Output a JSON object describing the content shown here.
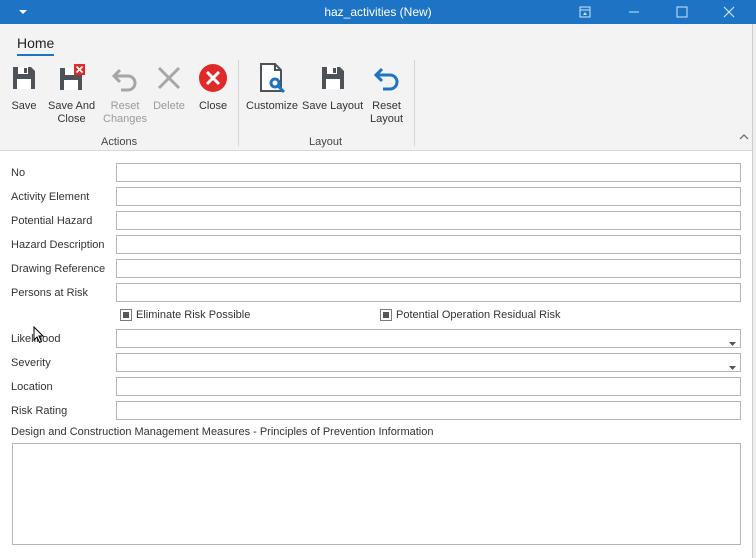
{
  "window": {
    "title": "haz_activities (New)",
    "colors": {
      "titlebar": "#1e74c4",
      "accent": "#1e74c4",
      "close_icon": "#e02a2a"
    }
  },
  "ribbon": {
    "tab": "Home",
    "groups": [
      {
        "label": "Actions"
      },
      {
        "label": "Layout"
      }
    ],
    "buttons": {
      "save": "Save",
      "save_and_close": "Save And\nClose",
      "reset_changes": "Reset\nChanges",
      "delete": "Delete",
      "close": "Close",
      "customize": "Customize",
      "save_layout": "Save Layout",
      "reset_layout": "Reset\nLayout"
    }
  },
  "form": {
    "fields": {
      "no": {
        "label": "No",
        "value": ""
      },
      "activity_element": {
        "label": "Activity Element",
        "value": ""
      },
      "potential_hazard": {
        "label": "Potential Hazard",
        "value": ""
      },
      "hazard_description": {
        "label": "Hazard Description",
        "value": ""
      },
      "drawing_reference": {
        "label": "Drawing Reference",
        "value": ""
      },
      "persons_at_risk": {
        "label": "Persons at Risk",
        "value": ""
      },
      "likelihood": {
        "label": "Likelihood",
        "value": ""
      },
      "severity": {
        "label": "Severity",
        "value": ""
      },
      "location": {
        "label": "Location",
        "value": ""
      },
      "risk_rating": {
        "label": "Risk Rating",
        "value": ""
      }
    },
    "checkboxes": {
      "eliminate_risk": {
        "label": "Eliminate Risk Possible",
        "state": "indeterminate"
      },
      "residual_risk": {
        "label": "Potential Operation Residual Risk",
        "state": "indeterminate"
      }
    },
    "memo": {
      "label": "Design and Construction Management Measures - Principles of Prevention Information",
      "value": ""
    }
  }
}
